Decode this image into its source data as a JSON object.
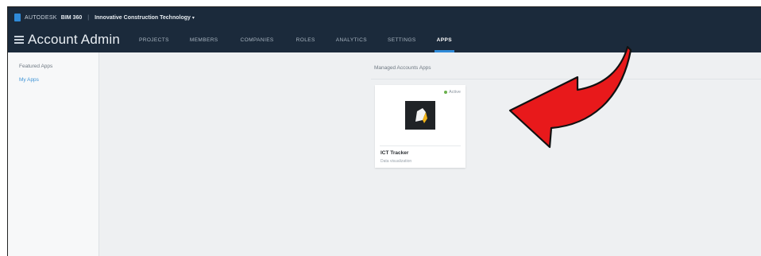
{
  "header": {
    "brand_name": "AUTODESK",
    "brand_product": "BIM 360",
    "account_name": "Innovative Construction Technology",
    "page_title": "Account Admin",
    "nav_items": [
      {
        "label": "PROJECTS",
        "active": false
      },
      {
        "label": "MEMBERS",
        "active": false
      },
      {
        "label": "COMPANIES",
        "active": false
      },
      {
        "label": "ROLES",
        "active": false
      },
      {
        "label": "ANALYTICS",
        "active": false
      },
      {
        "label": "SETTINGS",
        "active": false
      },
      {
        "label": "APPS",
        "active": true
      }
    ]
  },
  "sidebar": {
    "heading": "Featured Apps",
    "link": "My Apps"
  },
  "main": {
    "section_title": "Managed Accounts Apps",
    "app": {
      "status": "Active",
      "name": "ICT Tracker",
      "category": "Data visualization"
    }
  },
  "colors": {
    "topbar": "#1b2a3b",
    "accent": "#2f8ad8",
    "status_active": "#6ab04c",
    "annotation_arrow": "#e8191b"
  },
  "icons": [
    "autodesk-logo-icon",
    "menu-icon",
    "chevron-down-icon",
    "app-logo-icon",
    "red-arrow-annotation"
  ]
}
